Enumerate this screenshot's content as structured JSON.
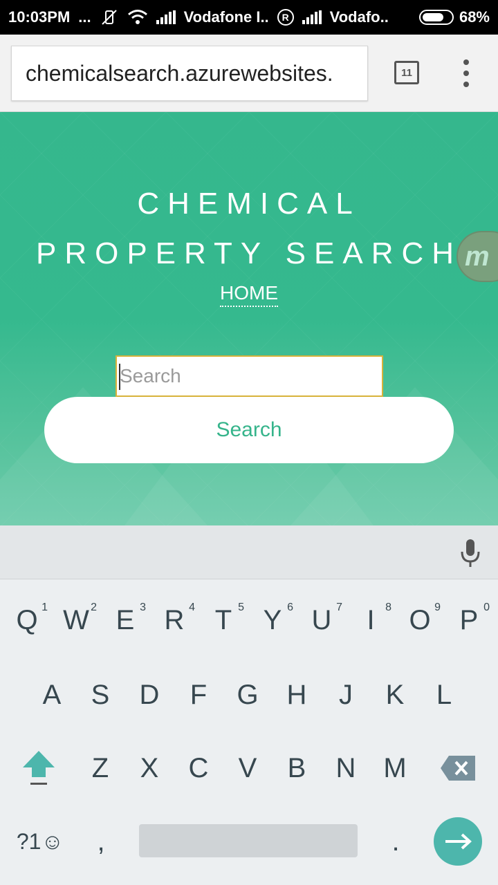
{
  "status_bar": {
    "time": "10:03PM",
    "dots": "...",
    "carrier1": "Vodafone I..",
    "roaming": "R",
    "carrier2": "Vodafo..",
    "battery": "68%"
  },
  "browser": {
    "url": "chemicalsearch.azurewebsites.",
    "tab_count": "11"
  },
  "page": {
    "title_line1": "CHEMICAL",
    "title_line2": "PROPERTY SEARCH",
    "home_link": "HOME",
    "badge_letter": "m",
    "search_placeholder": "Search",
    "search_button": "Search"
  },
  "keyboard": {
    "row1": [
      {
        "k": "Q",
        "n": "1"
      },
      {
        "k": "W",
        "n": "2"
      },
      {
        "k": "E",
        "n": "3"
      },
      {
        "k": "R",
        "n": "4"
      },
      {
        "k": "T",
        "n": "5"
      },
      {
        "k": "Y",
        "n": "6"
      },
      {
        "k": "U",
        "n": "7"
      },
      {
        "k": "I",
        "n": "8"
      },
      {
        "k": "O",
        "n": "9"
      },
      {
        "k": "P",
        "n": "0"
      }
    ],
    "row2": [
      "A",
      "S",
      "D",
      "F",
      "G",
      "H",
      "J",
      "K",
      "L"
    ],
    "row3": [
      "Z",
      "X",
      "C",
      "V",
      "B",
      "N",
      "M"
    ],
    "symbols_key": "?1☺",
    "comma": ",",
    "period": "."
  },
  "colors": {
    "hero": "#35b78d",
    "accent_text": "#36b48b",
    "input_border": "#d8b23a",
    "enter_key": "#4db6ac",
    "shift_key": "#4db6ac"
  }
}
